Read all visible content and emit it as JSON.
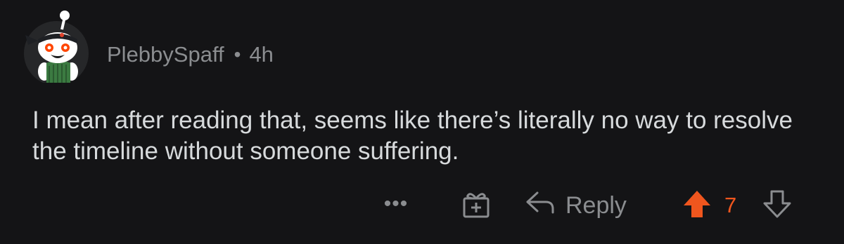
{
  "comment": {
    "username": "PlebbySpaff",
    "separator": "•",
    "timestamp": "4h",
    "text": "I mean after reading that, seems like there’s literally no way to resolve the timeline without someone suffering.",
    "avatar_icon": "snoo-avatar-icon"
  },
  "actions": {
    "more_label": "•••",
    "award_icon": "gift-icon",
    "reply_icon": "reply-arrow-icon",
    "reply_label": "Reply",
    "upvote_icon": "upvote-arrow-icon",
    "score": "7",
    "downvote_icon": "downvote-arrow-icon"
  },
  "colors": {
    "background": "#141416",
    "text": "#d7dadc",
    "muted": "#8b8d90",
    "upvote": "#f0561e"
  }
}
